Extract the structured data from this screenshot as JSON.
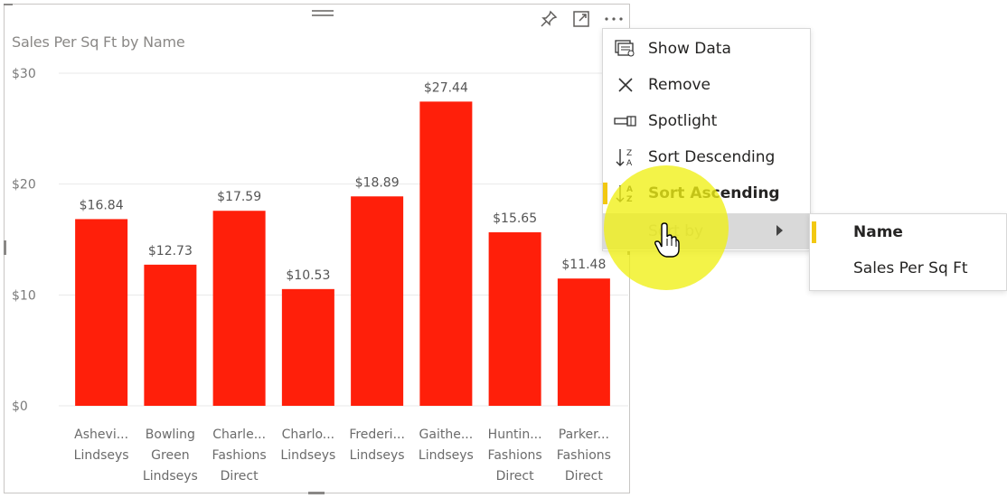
{
  "visual": {
    "title": "Sales Per Sq Ft by Name",
    "header_icons": [
      "pin-icon",
      "focus-mode-icon",
      "more-options-icon"
    ]
  },
  "chart_data": {
    "type": "bar",
    "title": "Sales Per Sq Ft by Name",
    "categories": [
      [
        "Ashevi...",
        "Lindseys"
      ],
      [
        "Bowling",
        "Green",
        "Lindseys"
      ],
      [
        "Charle...",
        "Fashions",
        "Direct"
      ],
      [
        "Charlo...",
        "Lindseys"
      ],
      [
        "Frederi...",
        "Lindseys"
      ],
      [
        "Gaithe...",
        "Lindseys"
      ],
      [
        "Huntin...",
        "Fashions",
        "Direct"
      ],
      [
        "Parker...",
        "Fashions",
        "Direct"
      ]
    ],
    "values": [
      16.84,
      12.73,
      17.59,
      10.53,
      18.89,
      27.44,
      15.65,
      11.48
    ],
    "data_labels": [
      "$16.84",
      "$12.73",
      "$17.59",
      "$10.53",
      "$18.89",
      "$27.44",
      "$15.65",
      "$11.48"
    ],
    "y_ticks": [
      0,
      10,
      20,
      30
    ],
    "y_tick_labels": [
      "$0",
      "$10",
      "$20",
      "$30"
    ],
    "ylim": [
      0,
      30
    ],
    "grid": true,
    "bar_color": "#ff1f0a"
  },
  "context_menu": {
    "items": [
      {
        "label": "Show Data",
        "icon": "show-data-icon"
      },
      {
        "label": "Remove",
        "icon": "close-icon"
      },
      {
        "label": "Spotlight",
        "icon": "spotlight-icon"
      },
      {
        "label": "Sort Descending",
        "icon": "sort-descending-icon"
      },
      {
        "label": "Sort Ascending",
        "icon": "sort-ascending-icon"
      },
      {
        "label": "Sort by",
        "icon": ""
      }
    ],
    "sort_by_submenu": [
      {
        "label": "Name",
        "selected": true
      },
      {
        "label": "Sales Per Sq Ft",
        "selected": false
      }
    ]
  },
  "colors": {
    "accent": "#f2c811",
    "highlight": "#f0f014"
  }
}
